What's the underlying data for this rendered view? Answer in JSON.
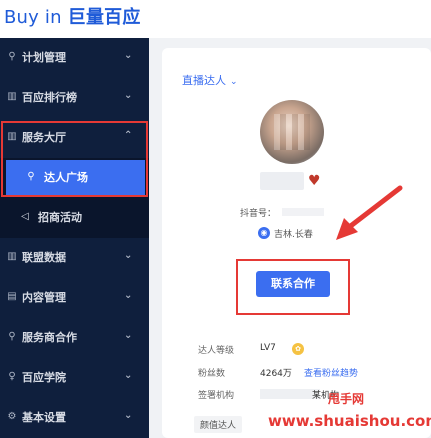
{
  "brand": {
    "logo_en": "Buy in",
    "logo_cn": "巨量百应"
  },
  "sidebar": {
    "items": [
      {
        "label": "计划管理",
        "icon": "user-plan-icon",
        "glyph": "⚲",
        "chevron": "⌄"
      },
      {
        "label": "百应排行榜",
        "icon": "bar-chart-icon",
        "glyph": "▥",
        "chevron": "⌄"
      },
      {
        "label": "服务大厅",
        "icon": "bar-chart-icon",
        "glyph": "▥",
        "chevron": "⌃"
      },
      {
        "label": "联盟数据",
        "icon": "bar-chart-icon",
        "glyph": "▥",
        "chevron": "⌄"
      },
      {
        "label": "内容管理",
        "icon": "document-icon",
        "glyph": "▤",
        "chevron": "⌄"
      },
      {
        "label": "服务商合作",
        "icon": "user-icon",
        "glyph": "⚲",
        "chevron": "⌄"
      },
      {
        "label": "百应学院",
        "icon": "bulb-icon",
        "glyph": "♀",
        "chevron": "⌄"
      },
      {
        "label": "基本设置",
        "icon": "gear-icon",
        "glyph": "⚙",
        "chevron": "⌄"
      }
    ],
    "sub_items": [
      {
        "label": "达人广场",
        "icon": "person-icon",
        "glyph": "⚲"
      },
      {
        "label": "招商活动",
        "icon": "send-icon",
        "glyph": "◁"
      }
    ]
  },
  "card": {
    "tab_label": "直播达人",
    "tab_caret": "⌄",
    "douyin_label": "抖音号：",
    "location_glyph": "◉",
    "location": "吉林.长春",
    "contact_button": "联系合作",
    "rows": [
      {
        "label": "达人等级",
        "value": "LV7"
      },
      {
        "label": "粉丝数",
        "value": "4264万",
        "link": "查看粉丝趋势"
      },
      {
        "label": "签署机构",
        "value": "某机构"
      }
    ],
    "lv_badge": "✿",
    "tag": "颜值达人"
  },
  "watermark": {
    "cn": "甩手网",
    "url": "www.shuaishou.com"
  },
  "colors": {
    "accent": "#3b6ef0",
    "sidebar_bg": "#0f1f3d",
    "highlight_red": "#e53935"
  }
}
